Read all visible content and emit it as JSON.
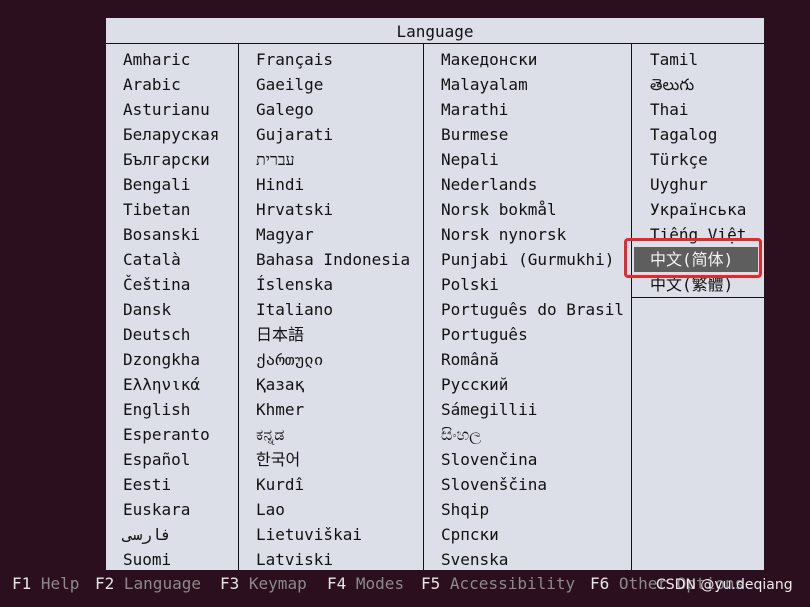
{
  "dialog": {
    "title": "Language",
    "columns": [
      [
        "Amharic",
        "Arabic",
        "Asturianu",
        "Беларуская",
        "Български",
        "Bengali",
        "Tibetan",
        "Bosanski",
        "Català",
        "Čeština",
        "Dansk",
        "Deutsch",
        "Dzongkha",
        "Ελληνικά",
        "English",
        "Esperanto",
        "Español",
        "Eesti",
        "Euskara",
        "فارسی",
        "Suomi"
      ],
      [
        "Français",
        "Gaeilge",
        "Galego",
        "Gujarati",
        "עברית",
        "Hindi",
        "Hrvatski",
        "Magyar",
        "Bahasa Indonesia",
        "Íslenska",
        "Italiano",
        "日本語",
        "ქართული",
        "Қазақ",
        "Khmer",
        "ಕನ್ನಡ",
        "한국어",
        "Kurdî",
        "Lao",
        "Lietuviškai",
        "Latviski"
      ],
      [
        "Македонски",
        "Malayalam",
        "Marathi",
        "Burmese",
        "Nepali",
        "Nederlands",
        "Norsk bokmål",
        "Norsk nynorsk",
        "Punjabi (Gurmukhi)",
        "Polski",
        "Português do Brasil",
        "Português",
        "Română",
        "Русский",
        "Sámegillii",
        "සිංහල",
        "Slovenčina",
        "Slovenščina",
        "Shqip",
        "Српски",
        "Svenska"
      ],
      [
        "Tamil",
        "తెలుగు",
        "Thai",
        "Tagalog",
        "Türkçe",
        "Uyghur",
        "Українська",
        "Tiếng Việt",
        "中文(简体)",
        "中文(繁體)"
      ]
    ],
    "selected": "中文(简体)"
  },
  "footer": {
    "keys": [
      {
        "key": "F1",
        "label": "Help"
      },
      {
        "key": "F2",
        "label": "Language"
      },
      {
        "key": "F3",
        "label": "Keymap"
      },
      {
        "key": "F4",
        "label": "Modes"
      },
      {
        "key": "F5",
        "label": "Accessibility"
      },
      {
        "key": "F6",
        "label": "Other Options"
      }
    ]
  },
  "watermark": "CSDN @yu.deqiang",
  "colors": {
    "background": "#2c0f1f",
    "dialog": "#dcdfe7",
    "selection": "#5f5e5e",
    "annotation": "#e8262b"
  }
}
